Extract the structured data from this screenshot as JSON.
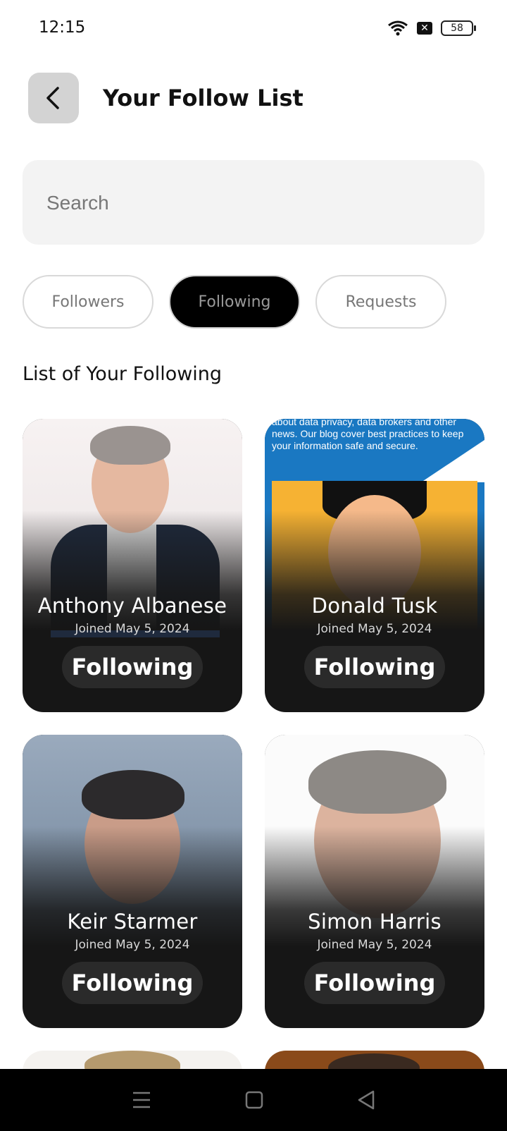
{
  "status": {
    "time": "12:15",
    "battery": "58"
  },
  "header": {
    "title": "Your Follow List"
  },
  "search": {
    "placeholder": "Search"
  },
  "tabs": [
    {
      "label": "Followers",
      "active": false
    },
    {
      "label": "Following",
      "active": true
    },
    {
      "label": "Requests",
      "active": false
    }
  ],
  "section_title": "List of Your Following",
  "cards": [
    {
      "name": "Anthony Albanese",
      "joined": "Joined May 5, 2024",
      "button": "Following"
    },
    {
      "name": "Donald Tusk",
      "joined": "Joined May 5, 2024",
      "button": "Following",
      "image_text": "about data privacy, data brokers and other news. Our blog cover best practices to keep your information safe and secure."
    },
    {
      "name": "Keir Starmer",
      "joined": "Joined May 5, 2024",
      "button": "Following"
    },
    {
      "name": "Simon Harris",
      "joined": "Joined May 5, 2024",
      "button": "Following"
    }
  ],
  "nav": {
    "menu_icon": "menu-icon",
    "home_icon": "home-square-icon",
    "back_icon": "back-triangle-icon"
  }
}
